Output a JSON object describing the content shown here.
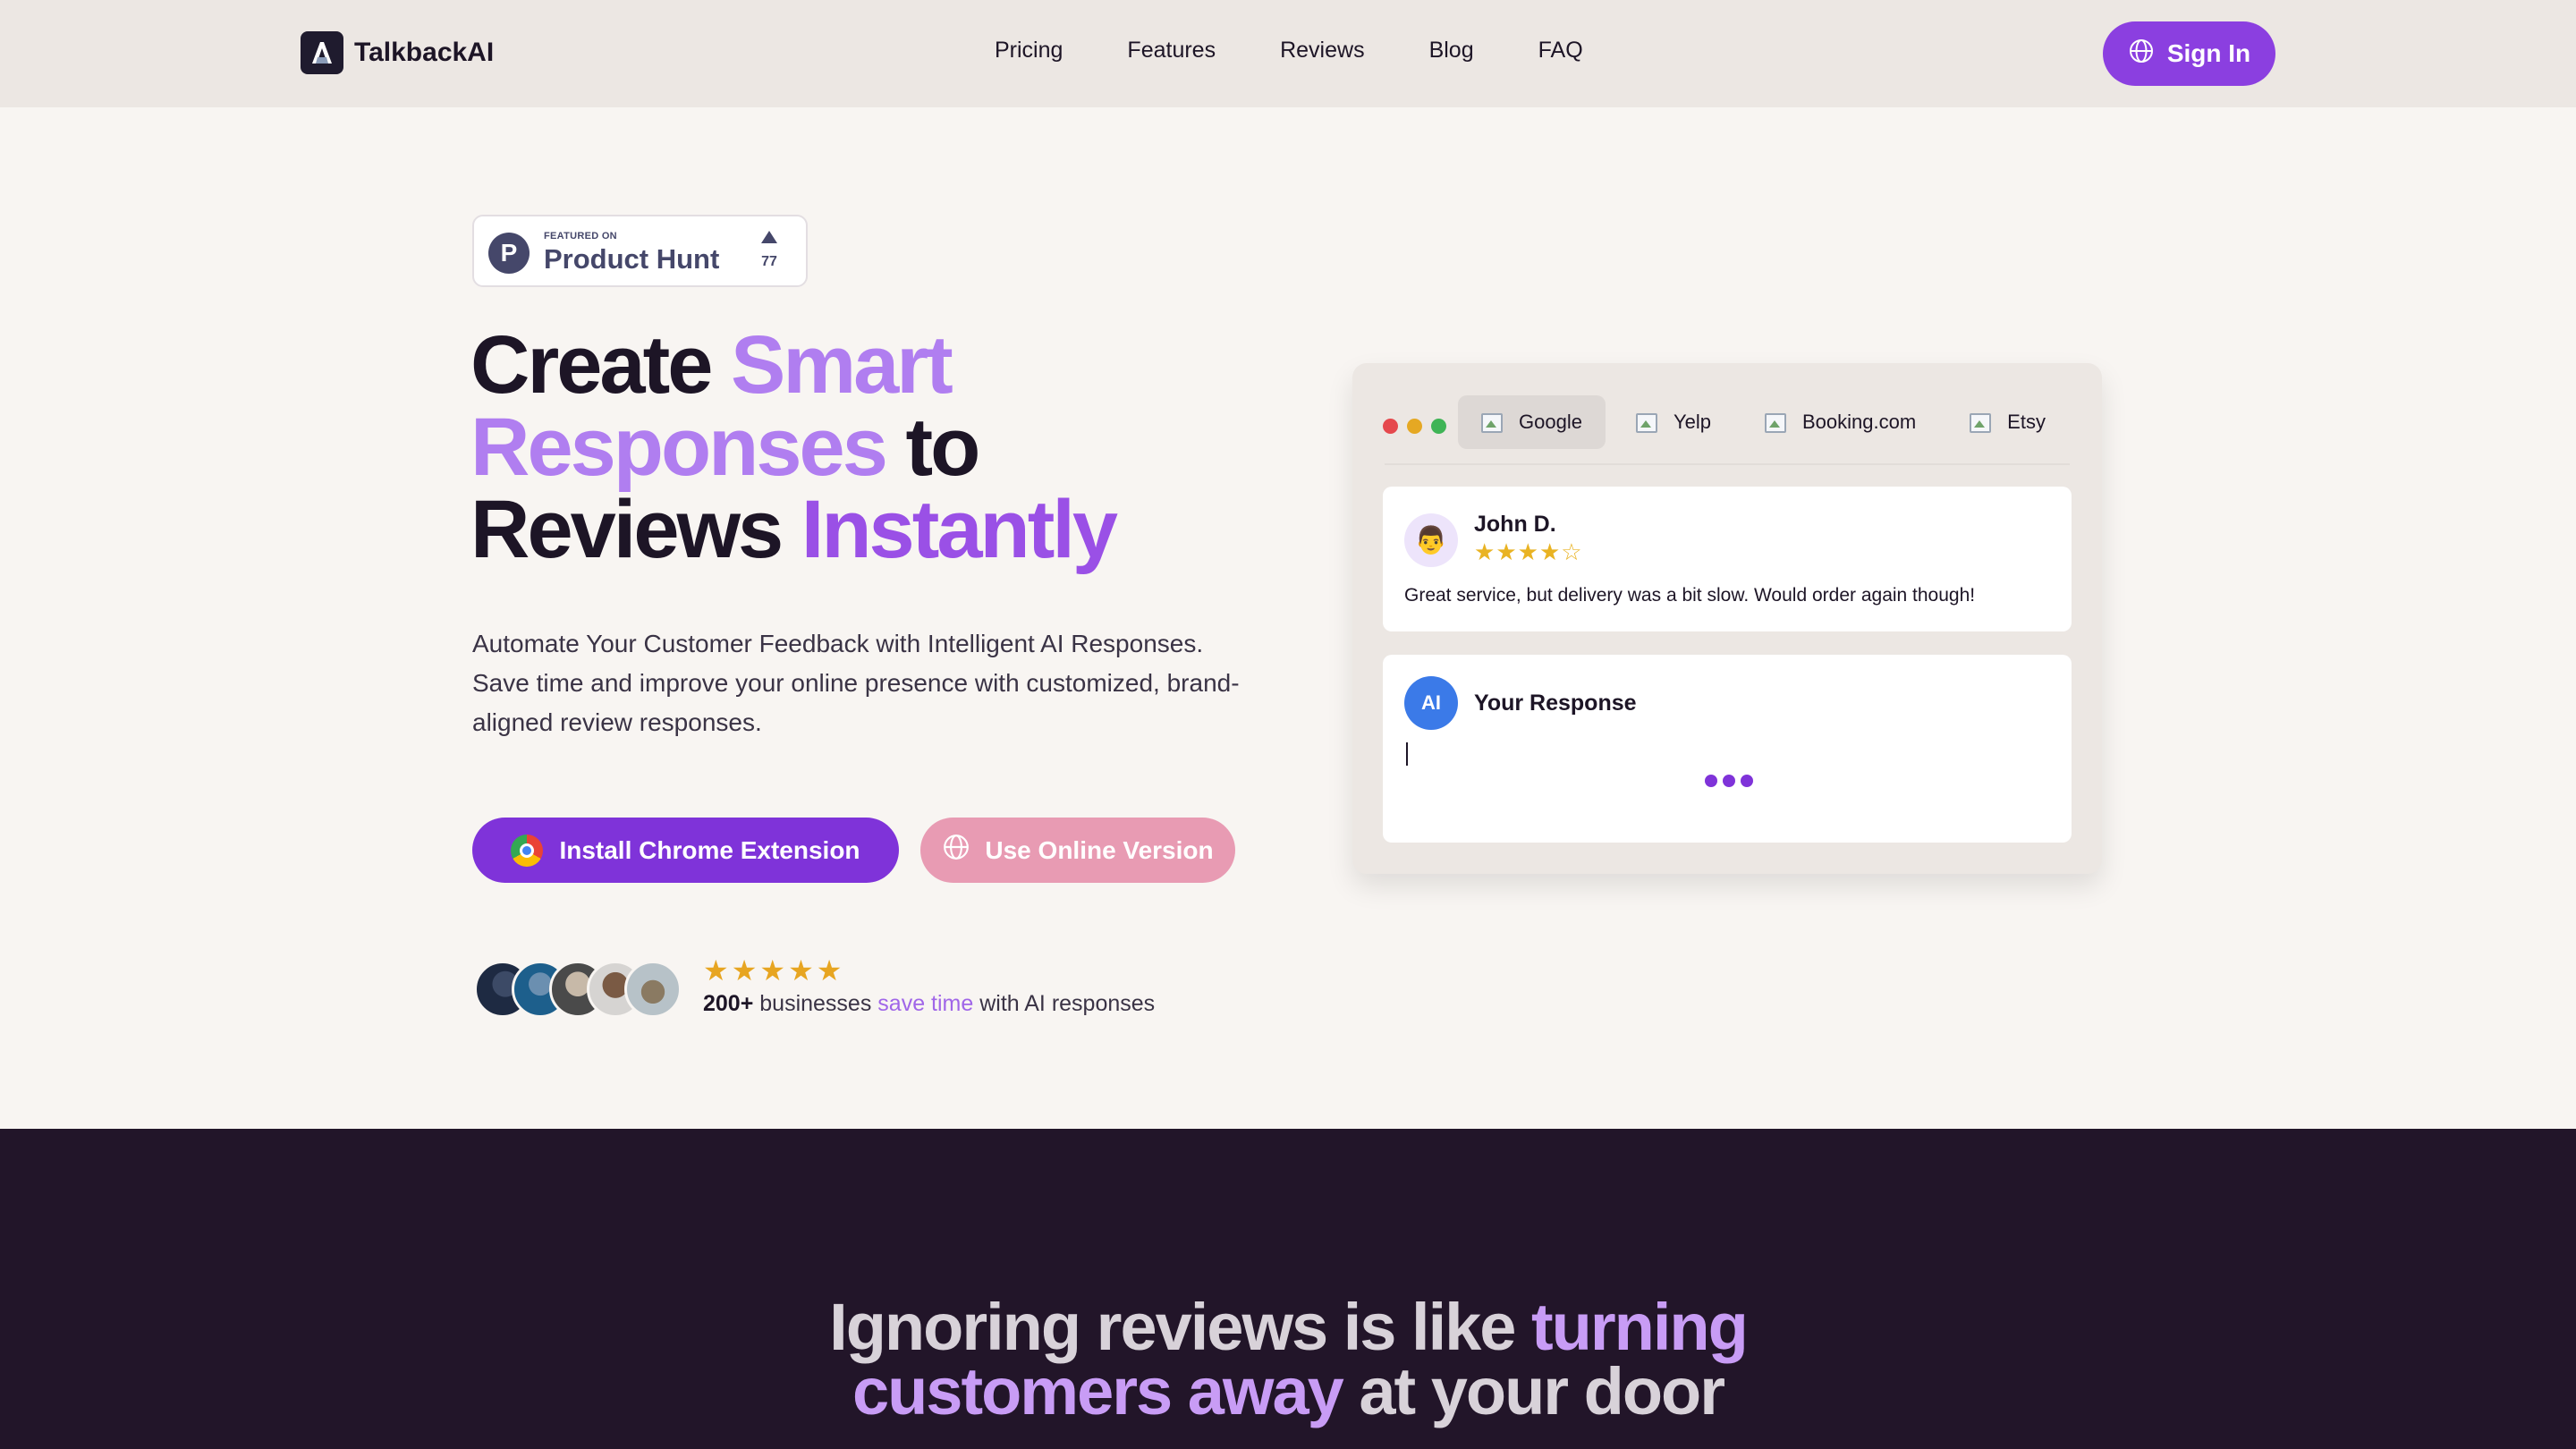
{
  "nav": {
    "brand": "TalkbackAI",
    "links": [
      "Pricing",
      "Features",
      "Reviews",
      "Blog",
      "FAQ"
    ],
    "signin_label": "Sign In"
  },
  "product_hunt": {
    "featured_on": "FEATURED ON",
    "name": "Product Hunt",
    "upvotes": "77"
  },
  "hero": {
    "headline": {
      "w1": "Create",
      "w2": "Smart",
      "w3": "Responses",
      "w4": "to",
      "w5": "Reviews",
      "w6": "Instantly"
    },
    "subtext": "Automate Your Customer Feedback with Intelligent AI Responses. Save time and improve your online presence with customized, brand-aligned review responses.",
    "install_label": "Install Chrome Extension",
    "online_label": "Use Online Version",
    "proof": {
      "count": "200+",
      "text1": "businesses",
      "accent": "save time",
      "text2": "with AI responses"
    }
  },
  "mock": {
    "tabs": [
      "Google",
      "Yelp",
      "Booking.com",
      "Etsy"
    ],
    "review": {
      "name": "John D.",
      "rating": 4,
      "text": "Great service, but delivery was a bit slow. Would order again though!"
    },
    "response": {
      "avatar_label": "AI",
      "title": "Your Response"
    }
  },
  "section2": {
    "part1": "Ignoring reviews is like",
    "accent1": "turning",
    "accent2": "customers away",
    "part2": "at your door"
  },
  "colors": {
    "primary": "#7f33d9",
    "pink": "#e89bb3",
    "dark_bg": "#221529"
  }
}
